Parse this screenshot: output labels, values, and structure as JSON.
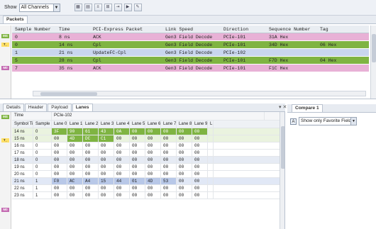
{
  "toolbar": {
    "show_label": "Show",
    "channel_select": "All Channels",
    "buttons": [
      "grid-icon",
      "filter-icon",
      "list-icon",
      "tree-icon",
      "export-icon",
      "play-icon",
      "config-icon"
    ]
  },
  "tabs_top": [
    "Packets"
  ],
  "upper": {
    "headers": [
      "Sample Number",
      "Time",
      "PCI-Express Packet",
      "Link Speed",
      "Direction",
      "Sequence Number",
      "Tag"
    ],
    "rows": [
      {
        "marker": "",
        "cells": [
          "0",
          "8 ns",
          "ACK",
          "Gen3 Field Decode",
          "PCIe-101",
          "31A Hex",
          ""
        ],
        "color": "#e8b1d6"
      },
      {
        "marker": "",
        "cells": [
          "0",
          "14 ns",
          "Cpl",
          "Gen3 Field Decode",
          "PCIe-101",
          "34D Hex",
          "06 Hex"
        ],
        "color": "#7fb442"
      },
      {
        "marker": "",
        "cells": [
          "1",
          "21 ns",
          "UpdateFC-Cpl",
          "Gen3 Field Decode",
          "PCIe-102",
          "",
          ""
        ],
        "color": "#c9d6ee"
      },
      {
        "marker": "",
        "cells": [
          "5",
          "28 ns",
          "Cpl",
          "Gen3 Field Decode",
          "PCIe-101",
          "F7D Hex",
          "04 Hex"
        ],
        "color": "#7fb442"
      },
      {
        "marker": "",
        "cells": [
          "7",
          "35 ns",
          "ACK",
          "Gen3 Field Decode",
          "PCIe-101",
          "F1C Hex",
          ""
        ],
        "color": "#e8b1d6"
      }
    ],
    "side_markers": [
      "MS",
      "T_",
      "M0"
    ]
  },
  "tabs_lower": [
    "Details",
    "Header",
    "Payload",
    "Lanes"
  ],
  "lower": {
    "header_top": [
      "Time",
      "PCIe-102"
    ],
    "header_sub": [
      "Symbol Time",
      "Sample",
      "Lane 0",
      "Lane 1",
      "Lane 2",
      "Lane 3",
      "Lane 4",
      "Lane 5",
      "Lane 6",
      "Lane 7",
      "Lane 8",
      "Lane 9",
      "L"
    ],
    "rows": [
      {
        "time": "14 ns",
        "sample": "0",
        "lanes": [
          "3F",
          "90",
          "61",
          "43",
          "0A",
          "00",
          "00",
          "00",
          "00",
          "00",
          ""
        ]
      },
      {
        "time": "15 ns",
        "sample": "0",
        "lanes": [
          "00",
          "4D",
          "DC",
          "C1",
          "00",
          "00",
          "00",
          "00",
          "00",
          "00",
          ""
        ]
      },
      {
        "time": "16 ns",
        "sample": "0",
        "lanes": [
          "00",
          "00",
          "00",
          "00",
          "00",
          "00",
          "00",
          "00",
          "00",
          "00",
          ""
        ]
      },
      {
        "time": "17 ns",
        "sample": "0",
        "lanes": [
          "00",
          "00",
          "00",
          "00",
          "00",
          "00",
          "00",
          "00",
          "00",
          "00",
          ""
        ]
      },
      {
        "time": "18 ns",
        "sample": "0",
        "lanes": [
          "00",
          "00",
          "00",
          "00",
          "00",
          "00",
          "00",
          "00",
          "00",
          "00",
          ""
        ]
      },
      {
        "time": "19 ns",
        "sample": "0",
        "lanes": [
          "00",
          "00",
          "00",
          "00",
          "00",
          "00",
          "00",
          "00",
          "00",
          "00",
          ""
        ]
      },
      {
        "time": "20 ns",
        "sample": "0",
        "lanes": [
          "00",
          "00",
          "00",
          "00",
          "00",
          "00",
          "00",
          "00",
          "00",
          "00",
          ""
        ]
      },
      {
        "time": "21 ns",
        "sample": "1",
        "lanes": [
          "F0",
          "AC",
          "A4",
          "15",
          "44",
          "01",
          "4D",
          "53",
          "00",
          "00",
          ""
        ]
      },
      {
        "time": "22 ns",
        "sample": "1",
        "lanes": [
          "00",
          "00",
          "00",
          "00",
          "00",
          "00",
          "00",
          "00",
          "00",
          "00",
          ""
        ]
      },
      {
        "time": "23 ns",
        "sample": "1",
        "lanes": [
          "00",
          "00",
          "00",
          "00",
          "00",
          "00",
          "00",
          "00",
          "00",
          "00",
          ""
        ]
      }
    ],
    "side_markers": [
      "MS",
      "T_",
      "M0"
    ]
  },
  "right": {
    "tab": "Compare 1",
    "checkbox_label": "A",
    "select_value": "Show only Favorite Fields"
  },
  "colors": {
    "green": "#7fb442",
    "pink": "#e8b1d6",
    "blue": "#c9d6ee"
  }
}
